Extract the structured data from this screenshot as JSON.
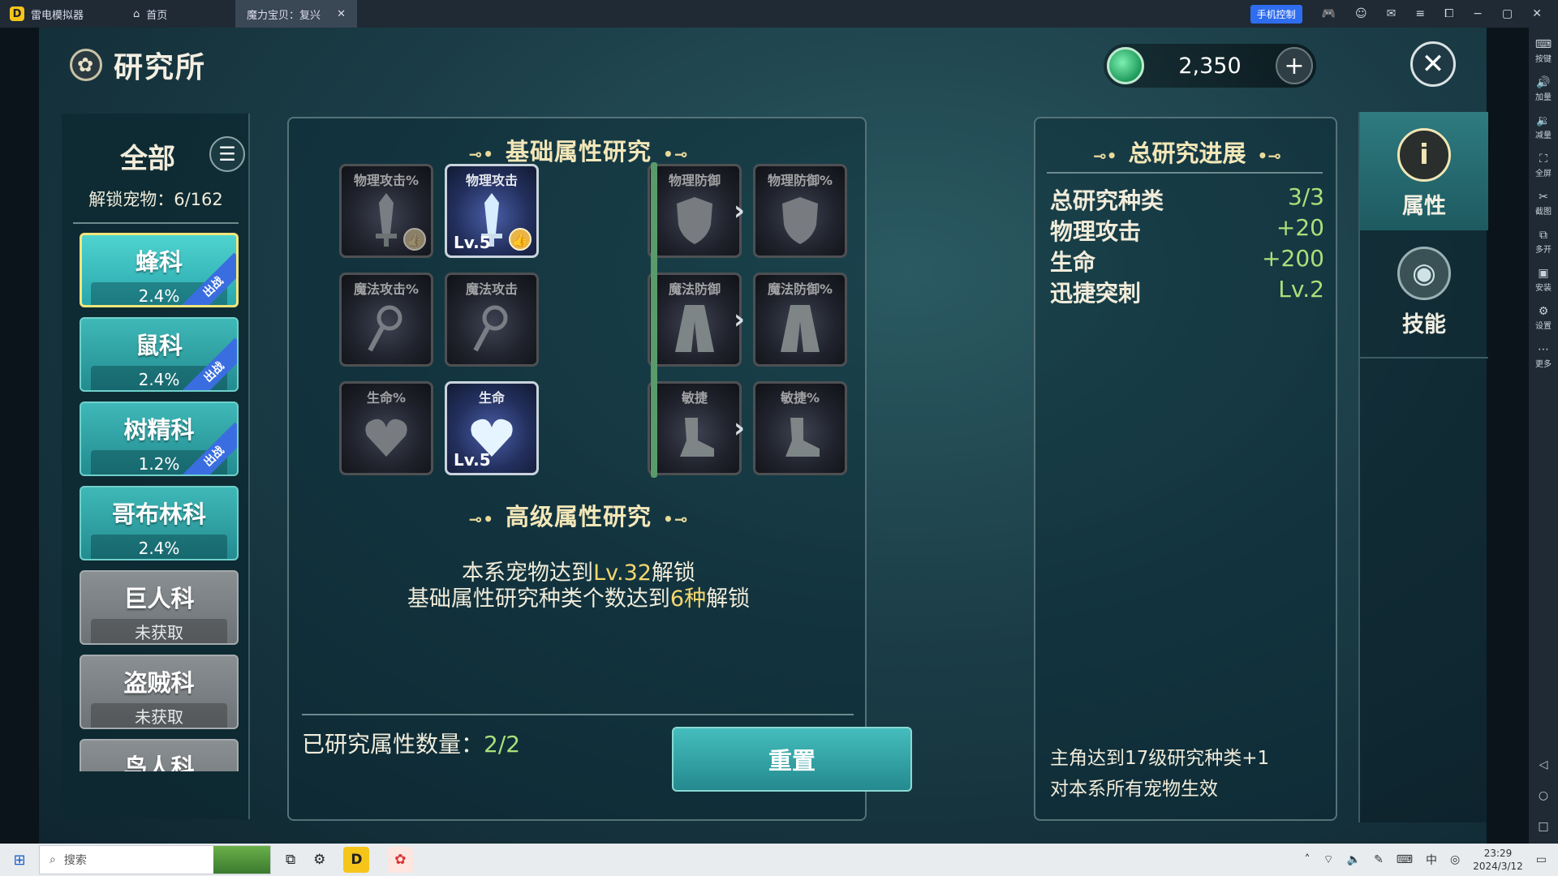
{
  "emulator": {
    "app_name": "雷电模拟器",
    "home_tab": "首页",
    "active_tab": "魔力宝贝：复兴",
    "phone_control": "手机控制",
    "tools": [
      {
        "icon": "keyboard-icon",
        "glyph": "⌨",
        "label": "按键"
      },
      {
        "icon": "volume-up-icon",
        "glyph": "🔊",
        "label": "加量"
      },
      {
        "icon": "volume-down-icon",
        "glyph": "🔉",
        "label": "减量"
      },
      {
        "icon": "fullscreen-icon",
        "glyph": "⛶",
        "label": "全屏"
      },
      {
        "icon": "scissors-icon",
        "glyph": "✂",
        "label": "截图"
      },
      {
        "icon": "multi-instance-icon",
        "glyph": "⧉",
        "label": "多开"
      },
      {
        "icon": "apk-install-icon",
        "glyph": "▣",
        "label": "安装"
      },
      {
        "icon": "settings-icon",
        "glyph": "⚙",
        "label": "设置"
      },
      {
        "icon": "more-icon",
        "glyph": "⋯",
        "label": "更多"
      }
    ]
  },
  "header": {
    "title": "研究所",
    "currency_amount": "2,350",
    "plus": "+",
    "close": "✕"
  },
  "left_panel": {
    "all_label": "全部",
    "menu_icon": "☰",
    "unlock_label": "解锁宠物：6/162",
    "families": [
      {
        "name": "蜂科",
        "value": "2.4%",
        "deployed": true,
        "selected": true,
        "locked": false
      },
      {
        "name": "鼠科",
        "value": "2.4%",
        "deployed": true,
        "selected": false,
        "locked": false
      },
      {
        "name": "树精科",
        "value": "1.2%",
        "deployed": true,
        "selected": false,
        "locked": false
      },
      {
        "name": "哥布林科",
        "value": "2.4%",
        "deployed": false,
        "selected": false,
        "locked": false
      },
      {
        "name": "巨人科",
        "value": "未获取",
        "deployed": false,
        "selected": false,
        "locked": true
      },
      {
        "name": "盗贼科",
        "value": "未获取",
        "deployed": false,
        "selected": false,
        "locked": true
      },
      {
        "name": "鸟人科",
        "value": "",
        "deployed": false,
        "selected": false,
        "locked": true
      }
    ],
    "deployed_label": "出战"
  },
  "research": {
    "basic_title": "基础属性研究",
    "advanced_title": "高级属性研究",
    "deco_left": "⊸•",
    "deco_right": "•⊸",
    "nodes": {
      "phys_atk_pct": {
        "label": "物理攻击%",
        "lvl": "",
        "thumb": true
      },
      "phys_atk": {
        "label": "物理攻击",
        "lvl": "Lv.5",
        "thumb": true
      },
      "phys_def": {
        "label": "物理防御",
        "lvl": "",
        "thumb": false
      },
      "phys_def_pct": {
        "label": "物理防御%",
        "lvl": "",
        "thumb": false
      },
      "mag_atk_pct": {
        "label": "魔法攻击%",
        "lvl": "",
        "thumb": false
      },
      "mag_atk": {
        "label": "魔法攻击",
        "lvl": "",
        "thumb": false
      },
      "mag_def": {
        "label": "魔法防御",
        "lvl": "",
        "thumb": false
      },
      "mag_def_pct": {
        "label": "魔法防御%",
        "lvl": "",
        "thumb": false
      },
      "hp_pct": {
        "label": "生命%",
        "lvl": "",
        "thumb": false
      },
      "hp": {
        "label": "生命",
        "lvl": "Lv.5",
        "thumb": false
      },
      "agi": {
        "label": "敏捷",
        "lvl": "",
        "thumb": false
      },
      "agi_pct": {
        "label": "敏捷%",
        "lvl": "",
        "thumb": false
      }
    },
    "adv_line1_a": "本系宠物达到",
    "adv_line1_b": "Lv.32",
    "adv_line1_c": "解锁",
    "adv_line2_a": "基础属性研究种类个数达到",
    "adv_line2_b": "6种",
    "adv_line2_c": "解锁",
    "researched_label": "已研究属性数量：",
    "researched_value": "2/2",
    "reset_label": "重置"
  },
  "progress": {
    "title": "总研究进展",
    "stats": [
      {
        "k": "总研究种类",
        "v": "3/3"
      },
      {
        "k": "物理攻击",
        "v": "+20"
      },
      {
        "k": "生命",
        "v": "+200"
      },
      {
        "k": "迅捷突刺",
        "v": "Lv.2"
      }
    ],
    "note_line1": "主角达到17级研究种类+1",
    "note_line2": "对本系所有宠物生效"
  },
  "tabs": {
    "attributes": {
      "label": "属性",
      "glyph": "i"
    },
    "skills": {
      "label": "技能",
      "glyph": "◉"
    }
  },
  "taskbar": {
    "search_placeholder": "搜索",
    "time": "23:29",
    "date": "2024/3/12"
  }
}
